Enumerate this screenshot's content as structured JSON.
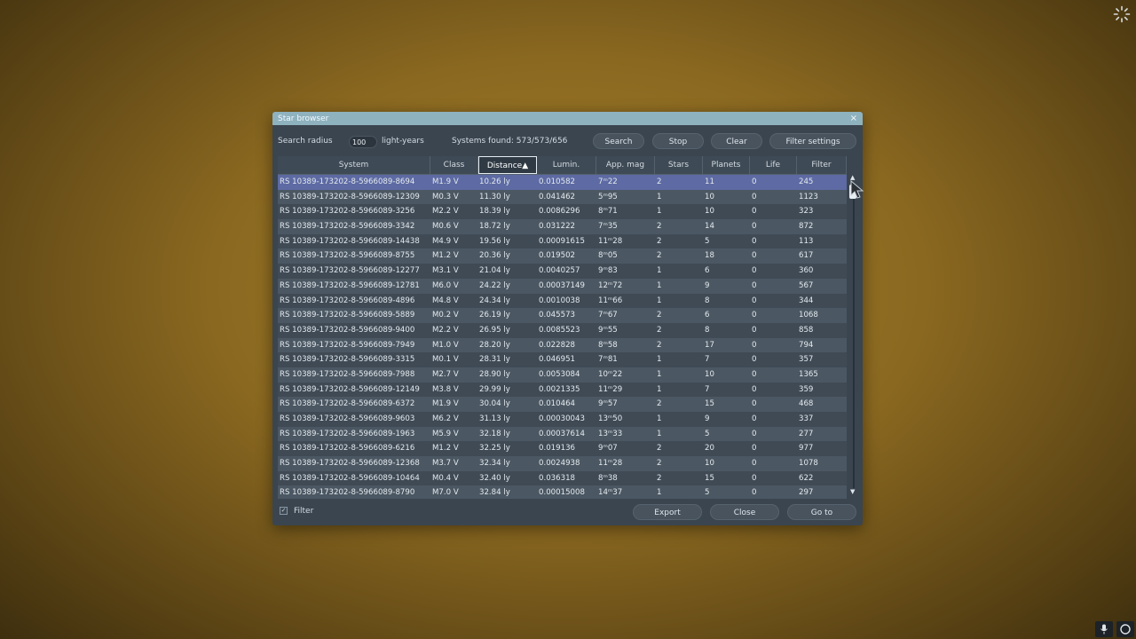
{
  "window": {
    "title": "Star browser",
    "close_glyph": "×"
  },
  "toolbar": {
    "search_radius_label": "Search radius",
    "search_radius_value": "100",
    "radius_unit": "light-years",
    "systems_found": "Systems found: 573/573/656",
    "search_label": "Search",
    "stop_label": "Stop",
    "clear_label": "Clear",
    "filter_settings_label": "Filter settings"
  },
  "table": {
    "columns": [
      {
        "key": "system",
        "label": "System"
      },
      {
        "key": "class",
        "label": "Class"
      },
      {
        "key": "distance",
        "label": "Distance▲"
      },
      {
        "key": "lumin",
        "label": "Lumin."
      },
      {
        "key": "appmag",
        "label": "App. mag"
      },
      {
        "key": "stars",
        "label": "Stars"
      },
      {
        "key": "planets",
        "label": "Planets"
      },
      {
        "key": "life",
        "label": "Life"
      },
      {
        "key": "filter",
        "label": "Filter"
      }
    ],
    "sorted_column": "distance",
    "selected_row": 0,
    "rows": [
      [
        "RS 10389-173202-8-5966089-8694",
        "M1.9 V",
        "10.26 ly",
        "0.010582",
        "7ᵐ22",
        "2",
        "11",
        "0",
        "245"
      ],
      [
        "RS 10389-173202-8-5966089-12309",
        "M0.3 V",
        "11.30 ly",
        "0.041462",
        "5ᵐ95",
        "1",
        "10",
        "0",
        "1123"
      ],
      [
        "RS 10389-173202-8-5966089-3256",
        "M2.2 V",
        "18.39 ly",
        "0.0086296",
        "8ᵐ71",
        "1",
        "10",
        "0",
        "323"
      ],
      [
        "RS 10389-173202-8-5966089-3342",
        "M0.6 V",
        "18.72 ly",
        "0.031222",
        "7ᵐ35",
        "2",
        "14",
        "0",
        "872"
      ],
      [
        "RS 10389-173202-8-5966089-14438",
        "M4.9 V",
        "19.56 ly",
        "0.00091615",
        "11ᵐ28",
        "2",
        "5",
        "0",
        "113"
      ],
      [
        "RS 10389-173202-8-5966089-8755",
        "M1.2 V",
        "20.36 ly",
        "0.019502",
        "8ᵐ05",
        "2",
        "18",
        "0",
        "617"
      ],
      [
        "RS 10389-173202-8-5966089-12277",
        "M3.1 V",
        "21.04 ly",
        "0.0040257",
        "9ᵐ83",
        "1",
        "6",
        "0",
        "360"
      ],
      [
        "RS 10389-173202-8-5966089-12781",
        "M6.0 V",
        "24.22 ly",
        "0.00037149",
        "12ᵐ72",
        "1",
        "9",
        "0",
        "567"
      ],
      [
        "RS 10389-173202-8-5966089-4896",
        "M4.8 V",
        "24.34 ly",
        "0.0010038",
        "11ᵐ66",
        "1",
        "8",
        "0",
        "344"
      ],
      [
        "RS 10389-173202-8-5966089-5889",
        "M0.2 V",
        "26.19 ly",
        "0.045573",
        "7ᵐ67",
        "2",
        "6",
        "0",
        "1068"
      ],
      [
        "RS 10389-173202-8-5966089-9400",
        "M2.2 V",
        "26.95 ly",
        "0.0085523",
        "9ᵐ55",
        "2",
        "8",
        "0",
        "858"
      ],
      [
        "RS 10389-173202-8-5966089-7949",
        "M1.0 V",
        "28.20 ly",
        "0.022828",
        "8ᵐ58",
        "2",
        "17",
        "0",
        "794"
      ],
      [
        "RS 10389-173202-8-5966089-3315",
        "M0.1 V",
        "28.31 ly",
        "0.046951",
        "7ᵐ81",
        "1",
        "7",
        "0",
        "357"
      ],
      [
        "RS 10389-173202-8-5966089-7988",
        "M2.7 V",
        "28.90 ly",
        "0.0053084",
        "10ᵐ22",
        "1",
        "10",
        "0",
        "1365"
      ],
      [
        "RS 10389-173202-8-5966089-12149",
        "M3.8 V",
        "29.99 ly",
        "0.0021335",
        "11ᵐ29",
        "1",
        "7",
        "0",
        "359"
      ],
      [
        "RS 10389-173202-8-5966089-6372",
        "M1.9 V",
        "30.04 ly",
        "0.010464",
        "9ᵐ57",
        "2",
        "15",
        "0",
        "468"
      ],
      [
        "RS 10389-173202-8-5966089-9603",
        "M6.2 V",
        "31.13 ly",
        "0.00030043",
        "13ᵐ50",
        "1",
        "9",
        "0",
        "337"
      ],
      [
        "RS 10389-173202-8-5966089-1963",
        "M5.9 V",
        "32.18 ly",
        "0.00037614",
        "13ᵐ33",
        "1",
        "5",
        "0",
        "277"
      ],
      [
        "RS 10389-173202-8-5966089-6216",
        "M1.2 V",
        "32.25 ly",
        "0.019136",
        "9ᵐ07",
        "2",
        "20",
        "0",
        "977"
      ],
      [
        "RS 10389-173202-8-5966089-12368",
        "M3.7 V",
        "32.34 ly",
        "0.0024938",
        "11ᵐ28",
        "2",
        "10",
        "0",
        "1078"
      ],
      [
        "RS 10389-173202-8-5966089-10464",
        "M0.4 V",
        "32.40 ly",
        "0.036318",
        "8ᵐ38",
        "2",
        "15",
        "0",
        "622"
      ],
      [
        "RS 10389-173202-8-5966089-8790",
        "M7.0 V",
        "32.84 ly",
        "0.00015008",
        "14ᵐ37",
        "1",
        "5",
        "0",
        "297"
      ]
    ]
  },
  "footer": {
    "filter_checkbox_label": "Filter",
    "filter_checked": true,
    "export_label": "Export",
    "close_label": "Close",
    "goto_label": "Go to"
  },
  "scroll": {
    "up_glyph": "▲",
    "down_glyph": "▼"
  },
  "colors": {
    "selected_row": "#5d6aa3",
    "titlebar": "#8fb2bf",
    "window_bg": "#3a4550"
  }
}
